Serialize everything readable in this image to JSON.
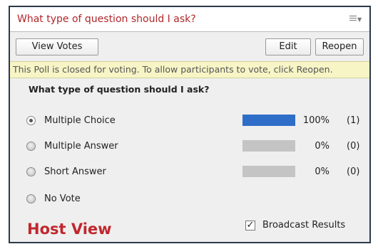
{
  "header": {
    "title": "What type of question should I ask?",
    "menu_icon": "menu-icon"
  },
  "toolbar": {
    "view_votes_label": "View Votes",
    "edit_label": "Edit",
    "reopen_label": "Reopen"
  },
  "notice": {
    "text": "This Poll is closed for voting. To allow participants to vote, click Reopen."
  },
  "poll": {
    "question": "What type of question should I ask?",
    "options": [
      {
        "label": "Multiple Choice",
        "selected": true,
        "percent_text": "100%",
        "percent": 100,
        "count_text": "(1)"
      },
      {
        "label": "Multiple Answer",
        "selected": false,
        "percent_text": "0%",
        "percent": 0,
        "count_text": "(0)"
      },
      {
        "label": "Short Answer",
        "selected": false,
        "percent_text": "0%",
        "percent": 0,
        "count_text": "(0)"
      },
      {
        "label": "No Vote",
        "selected": false
      }
    ]
  },
  "footer": {
    "host_view_label": "Host View",
    "broadcast_label": "Broadcast Results",
    "broadcast_checked": true
  },
  "colors": {
    "accent_red": "#b0262a",
    "bar_blue": "#2f6ec8",
    "bar_gray": "#c4c4c4",
    "notice_bg": "#f7f5c6"
  }
}
